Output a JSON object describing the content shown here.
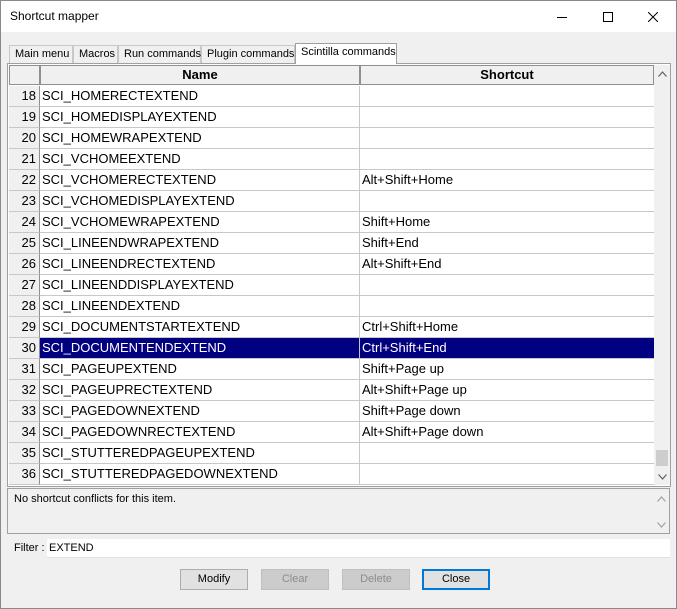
{
  "window": {
    "title": "Shortcut mapper"
  },
  "tabs": [
    {
      "label": "Main menu"
    },
    {
      "label": "Macros"
    },
    {
      "label": "Run commands"
    },
    {
      "label": "Plugin commands"
    },
    {
      "label": "Scintilla commands"
    }
  ],
  "table": {
    "columns": {
      "name": "Name",
      "shortcut": "Shortcut"
    },
    "selected_row": "30",
    "rows": [
      {
        "num": "18",
        "name": "SCI_HOMERECTEXTEND",
        "shortcut": ""
      },
      {
        "num": "19",
        "name": "SCI_HOMEDISPLAYEXTEND",
        "shortcut": ""
      },
      {
        "num": "20",
        "name": "SCI_HOMEWRAPEXTEND",
        "shortcut": ""
      },
      {
        "num": "21",
        "name": "SCI_VCHOMEEXTEND",
        "shortcut": ""
      },
      {
        "num": "22",
        "name": "SCI_VCHOMERECTEXTEND",
        "shortcut": "Alt+Shift+Home"
      },
      {
        "num": "23",
        "name": "SCI_VCHOMEDISPLAYEXTEND",
        "shortcut": ""
      },
      {
        "num": "24",
        "name": "SCI_VCHOMEWRAPEXTEND",
        "shortcut": "Shift+Home"
      },
      {
        "num": "25",
        "name": "SCI_LINEENDWRAPEXTEND",
        "shortcut": "Shift+End"
      },
      {
        "num": "26",
        "name": "SCI_LINEENDRECTEXTEND",
        "shortcut": "Alt+Shift+End"
      },
      {
        "num": "27",
        "name": "SCI_LINEENDDISPLAYEXTEND",
        "shortcut": ""
      },
      {
        "num": "28",
        "name": "SCI_LINEENDEXTEND",
        "shortcut": ""
      },
      {
        "num": "29",
        "name": "SCI_DOCUMENTSTARTEXTEND",
        "shortcut": "Ctrl+Shift+Home"
      },
      {
        "num": "30",
        "name": "SCI_DOCUMENTENDEXTEND",
        "shortcut": "Ctrl+Shift+End"
      },
      {
        "num": "31",
        "name": "SCI_PAGEUPEXTEND",
        "shortcut": "Shift+Page up"
      },
      {
        "num": "32",
        "name": "SCI_PAGEUPRECTEXTEND",
        "shortcut": "Alt+Shift+Page up"
      },
      {
        "num": "33",
        "name": "SCI_PAGEDOWNEXTEND",
        "shortcut": "Shift+Page down"
      },
      {
        "num": "34",
        "name": "SCI_PAGEDOWNRECTEXTEND",
        "shortcut": "Alt+Shift+Page down"
      },
      {
        "num": "35",
        "name": "SCI_STUTTEREDPAGEUPEXTEND",
        "shortcut": ""
      },
      {
        "num": "36",
        "name": "SCI_STUTTEREDPAGEDOWNEXTEND",
        "shortcut": ""
      }
    ]
  },
  "conflict": {
    "text": "No shortcut conflicts for this item."
  },
  "filter": {
    "label": "Filter :",
    "value": "EXTEND"
  },
  "buttons": {
    "modify": "Modify",
    "clear": "Clear",
    "delete": "Delete",
    "close": "Close"
  },
  "colors": {
    "selection": "#000080"
  }
}
